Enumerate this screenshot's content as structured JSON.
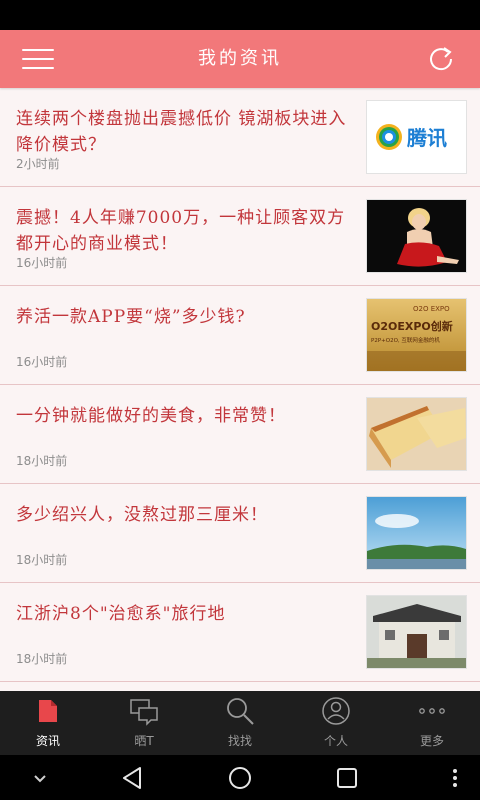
{
  "header": {
    "title": "我的资讯"
  },
  "news": [
    {
      "title": "连续两个楼盘抛出震撼低价 镜湖板块进入降价模式？",
      "time": "2小时前",
      "image": "tencent-logo",
      "logo_text": "腾讯"
    },
    {
      "title": "震撼！4人年赚7000万，一种让顾客双方都开心的商业模式！",
      "time": "16小时前",
      "image": "woman-in-red-dress"
    },
    {
      "title": "养活一款APP要“烧”多少钱?",
      "time": "16小时前",
      "image": "o2o-expo-banner",
      "banner_tag": "O2O EXPO",
      "banner_title": "O2OEXPO创新",
      "banner_subtitle": "P2P+O2O, 互联网金融的机"
    },
    {
      "title": "一分钟就能做好的美食，非常赞！",
      "time": "18小时前",
      "image": "cake-slices"
    },
    {
      "title": "多少绍兴人，没熬过那三厘米！",
      "time": "18小时前",
      "image": "shaoxing-scenery"
    },
    {
      "title": "江浙沪8个\"治愈系\"旅行地",
      "time": "18小时前",
      "image": "old-town-building"
    }
  ],
  "tabs": [
    {
      "label": "资讯",
      "icon": "news-document-icon",
      "active": true
    },
    {
      "label": "晒T",
      "icon": "chat-bubbles-icon",
      "active": false
    },
    {
      "label": "找找",
      "icon": "search-icon",
      "active": false
    },
    {
      "label": "个人",
      "icon": "user-icon",
      "active": false
    },
    {
      "label": "更多",
      "icon": "more-dots-icon",
      "active": false
    }
  ],
  "colors": {
    "appbar": "#f2787a",
    "title_text": "#c2363b",
    "tab_active": "#e8474b",
    "background": "#fbf4f4"
  }
}
